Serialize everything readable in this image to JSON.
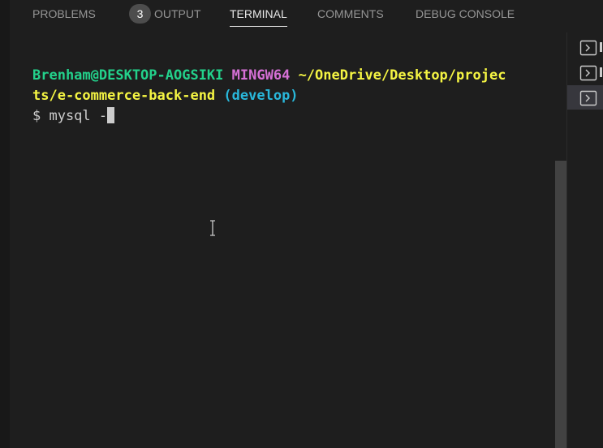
{
  "panel_tabs": [
    {
      "label": "PROBLEMS",
      "badge": "3"
    },
    {
      "label": "OUTPUT"
    },
    {
      "label": "TERMINAL",
      "active": true
    },
    {
      "label": "COMMENTS"
    },
    {
      "label": "DEBUG CONSOLE"
    }
  ],
  "terminal": {
    "prompt_user_host": "Brenham@DESKTOP-AOGSIKI",
    "prompt_env": "MINGW64",
    "prompt_path_line1": "~/OneDrive/Desktop/projec",
    "prompt_path_line2": "ts/e-commerce-back-end",
    "prompt_branch": "(develop)",
    "command_prompt": "$ mysql -"
  },
  "terminal_list": {
    "icons": [
      "terminal-icon",
      "terminal-icon",
      "terminal-icon"
    ],
    "selected_index": 2
  },
  "colors": {
    "background": "#1e1e1e",
    "user_host": "#23d18b",
    "env": "#d670d6",
    "path": "#f5f543",
    "branch": "#29b8db",
    "text": "#cccccc"
  }
}
